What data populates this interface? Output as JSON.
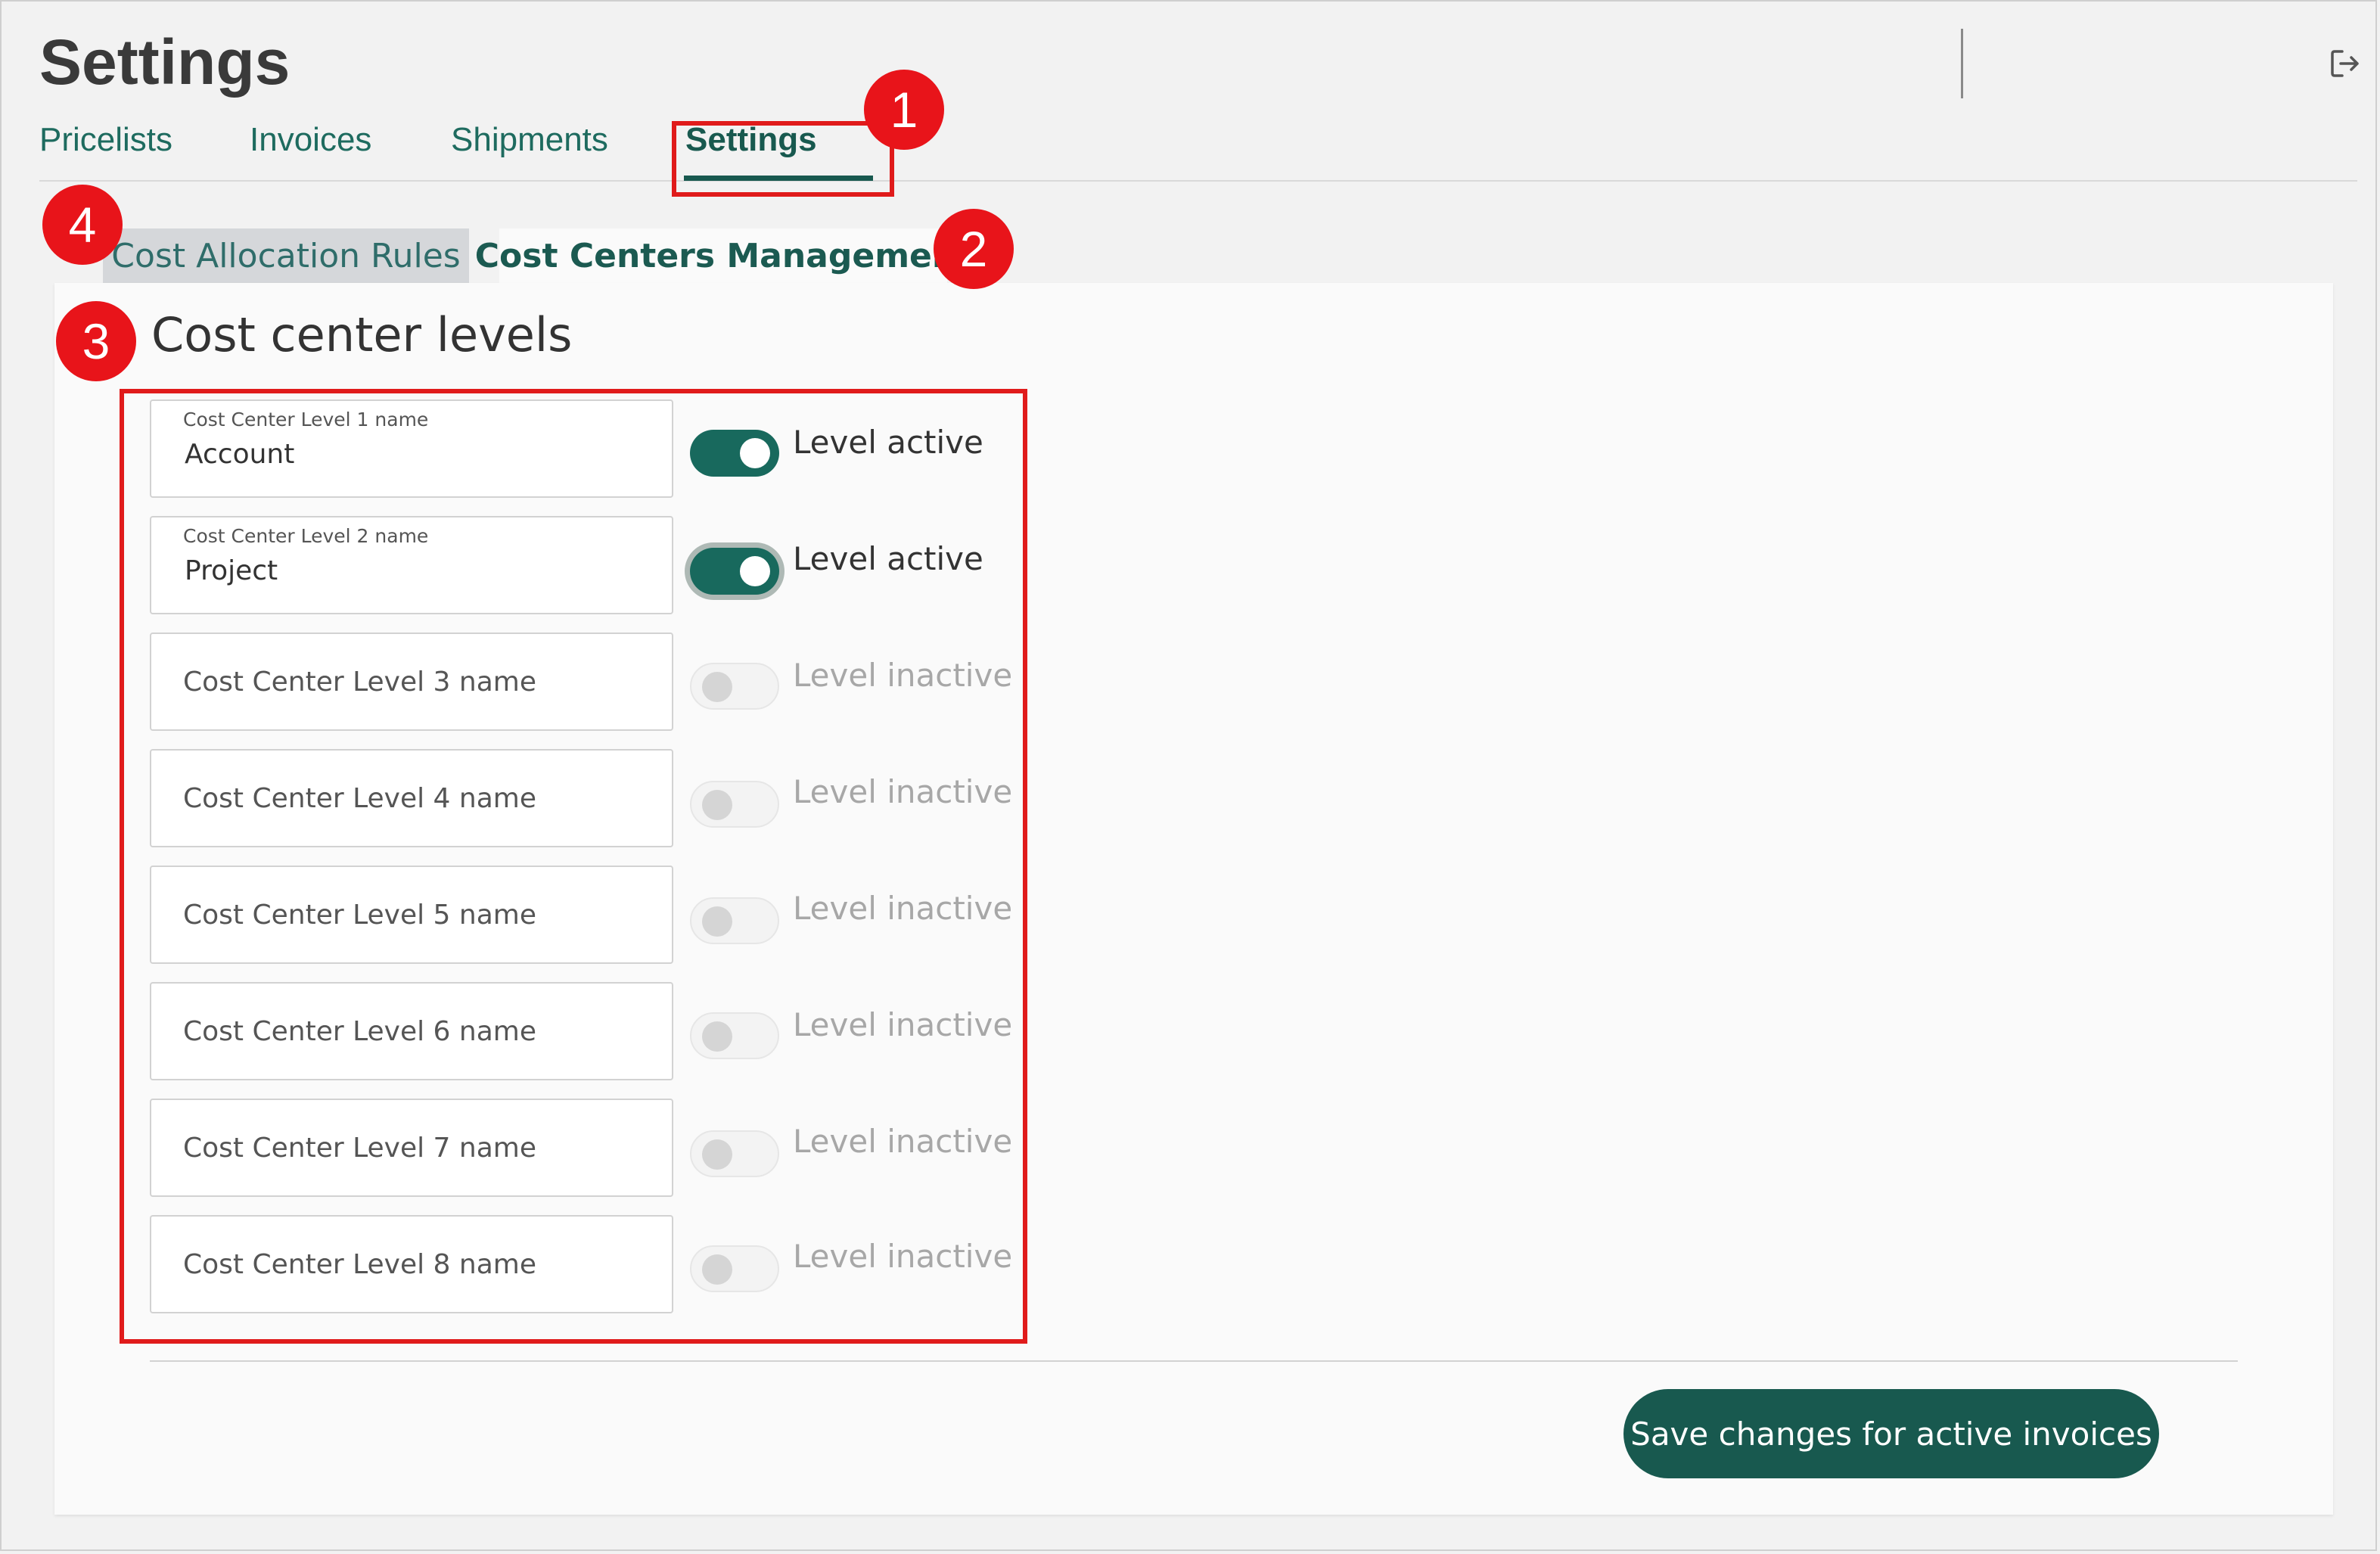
{
  "header": {
    "title": "Settings",
    "logout_icon": "logout-icon"
  },
  "nav": {
    "tabs": [
      {
        "label": "Pricelists",
        "active": false
      },
      {
        "label": "Invoices",
        "active": false
      },
      {
        "label": "Shipments",
        "active": false
      },
      {
        "label": "Settings",
        "active": true
      }
    ]
  },
  "subtabs": [
    {
      "label": "Cost Allocation Rules",
      "active": false
    },
    {
      "label": "Cost Centers Management",
      "active": true
    }
  ],
  "section": {
    "title": "Cost center levels"
  },
  "levels": [
    {
      "label": "Cost Center Level 1 name",
      "value": "Account",
      "active": true,
      "status": "Level active"
    },
    {
      "label": "Cost Center Level 2 name",
      "value": "Project",
      "active": true,
      "status": "Level active"
    },
    {
      "placeholder": "Cost Center Level 3 name",
      "value": "",
      "active": false,
      "status": "Level inactive"
    },
    {
      "placeholder": "Cost Center Level 4 name",
      "value": "",
      "active": false,
      "status": "Level inactive"
    },
    {
      "placeholder": "Cost Center Level 5 name",
      "value": "",
      "active": false,
      "status": "Level inactive"
    },
    {
      "placeholder": "Cost Center Level 6 name",
      "value": "",
      "active": false,
      "status": "Level inactive"
    },
    {
      "placeholder": "Cost Center Level 7 name",
      "value": "",
      "active": false,
      "status": "Level inactive"
    },
    {
      "placeholder": "Cost Center Level 8 name",
      "value": "",
      "active": false,
      "status": "Level inactive"
    }
  ],
  "footer": {
    "save_label": "Save changes for active invoices"
  },
  "annotations": {
    "callouts": [
      "1",
      "2",
      "3",
      "4"
    ],
    "highlight_color": "#e01b1b"
  },
  "colors": {
    "brand": "#18594f",
    "toggle_on": "#18695d",
    "callout": "#e8141a"
  }
}
